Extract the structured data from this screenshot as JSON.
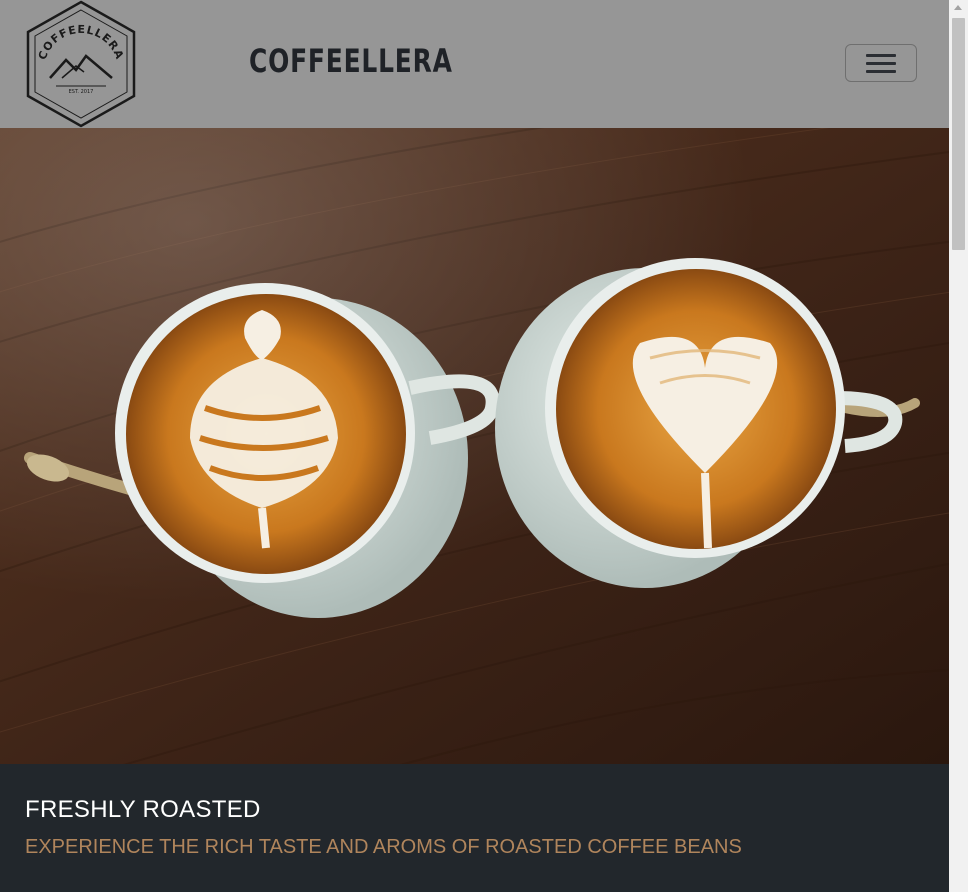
{
  "navbar": {
    "brand": "COFFEELLERA",
    "logo_text": "COFFEELLERA",
    "logo_est": "EST. 2017",
    "toggler_icon": "hamburger-icon"
  },
  "hero": {
    "image": "two-latte-art-cups-on-wood-table"
  },
  "caption": {
    "title": "FRESHLY ROASTED",
    "subtitle": "EXPERIENCE THE RICH TASTE AND AROMS OF ROASTED COFFEE BEANS"
  },
  "colors": {
    "navbar_bg": "#969696",
    "caption_bg": "#22272c",
    "subtitle": "#b0855c",
    "brand": "#1f2227"
  }
}
